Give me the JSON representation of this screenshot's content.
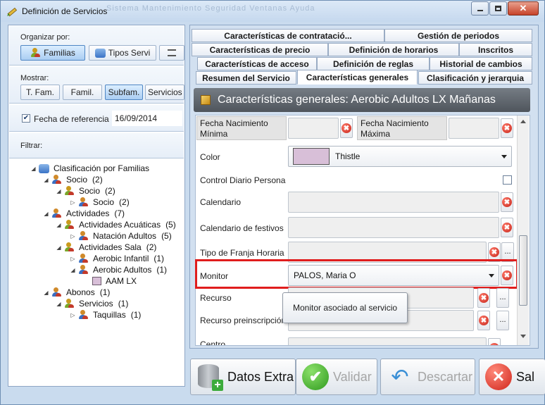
{
  "window": {
    "title": "Definición de Servicios",
    "ghost_text": "Sistema   Mantenimiento   Seguridad   Ventanas   Ayuda"
  },
  "left": {
    "organizar_label": "Organizar por:",
    "organizar_buttons": [
      "Familias",
      "Tipos Servi",
      ""
    ],
    "mostrar_label": "Mostrar:",
    "mostrar_buttons": [
      "T. Fam.",
      "Famil.",
      "Subfam.",
      "Servicios"
    ],
    "fecha_label": "Fecha de referencia",
    "fecha_value": "16/09/2014",
    "filtrar_label": "Filtrar:",
    "tree": [
      {
        "label": "Clasificación por Familias",
        "count": "",
        "level": 0,
        "exp": "◢",
        "icon": "database-icon"
      },
      {
        "label": "Socio",
        "count": "(2)",
        "level": 1,
        "exp": "◢",
        "icon": "people-icon"
      },
      {
        "label": "Socio",
        "count": "(2)",
        "level": 2,
        "exp": "◢",
        "icon": "group-icon"
      },
      {
        "label": "Socio",
        "count": "(2)",
        "level": 3,
        "exp": "▷",
        "icon": "people-icon"
      },
      {
        "label": "Actividades",
        "count": "(7)",
        "level": 1,
        "exp": "◢",
        "icon": "people-icon"
      },
      {
        "label": "Actividades Acuáticas",
        "count": "(5)",
        "level": 2,
        "exp": "◢",
        "icon": "group-icon"
      },
      {
        "label": "Natación Adultos",
        "count": "(5)",
        "level": 3,
        "exp": "▷",
        "icon": "people-icon"
      },
      {
        "label": "Actividades Sala",
        "count": "(2)",
        "level": 2,
        "exp": "◢",
        "icon": "group-icon"
      },
      {
        "label": "Aerobic Infantil",
        "count": "(1)",
        "level": 3,
        "exp": "▷",
        "icon": "people-icon"
      },
      {
        "label": "Aerobic Adultos",
        "count": "(1)",
        "level": 3,
        "exp": "◢",
        "icon": "people-icon"
      },
      {
        "label": "AAM LX",
        "count": "",
        "level": 4,
        "exp": "",
        "icon": "color-swatch-icon"
      },
      {
        "label": "Abonos",
        "count": "(1)",
        "level": 1,
        "exp": "◢",
        "icon": "people-icon"
      },
      {
        "label": "Servicios",
        "count": "(1)",
        "level": 2,
        "exp": "◢",
        "icon": "group-icon"
      },
      {
        "label": "Taquillas",
        "count": "(1)",
        "level": 3,
        "exp": "▷",
        "icon": "people-icon"
      }
    ]
  },
  "tabs": {
    "row1": [
      "Características de contratació...",
      "Gestión de periodos"
    ],
    "row2": [
      "Características de precio",
      "Definición de horarios",
      "Inscritos"
    ],
    "row3": [
      "Características de acceso",
      "Definición de reglas",
      "Historial de cambios"
    ],
    "row4": [
      "Resumen del Servicio",
      "Características generales",
      "Clasificación y jerarquia"
    ],
    "active": "Características generales"
  },
  "header": {
    "title": "Características generales: Aerobic Adultos LX Mañanas"
  },
  "form": {
    "fecha_min": "Fecha Nacimiento Mínima",
    "fecha_max": "Fecha Nacimiento Máxima",
    "color_label": "Color",
    "color_value": "Thistle",
    "color_hex": "#d8bfd8",
    "control_label": "Control Diario Persona",
    "calendario_label": "Calendario",
    "festivos_label": "Calendario de festivos",
    "franja_label": "Tipo de Franja Horaria",
    "monitor_label": "Monitor",
    "monitor_value": "PALOS, Maria O",
    "recurso_label": "Recurso",
    "recurso_pre_label": "Recurso preinscripción",
    "centro_label": "Centro",
    "x_symbol": "✖",
    "dots_symbol": "..."
  },
  "tooltip": "Monitor asociado al servicio",
  "buttons": {
    "datos_extra": "Datos Extra",
    "validar": "Validar",
    "descartar": "Descartar",
    "salir": "Sal"
  }
}
